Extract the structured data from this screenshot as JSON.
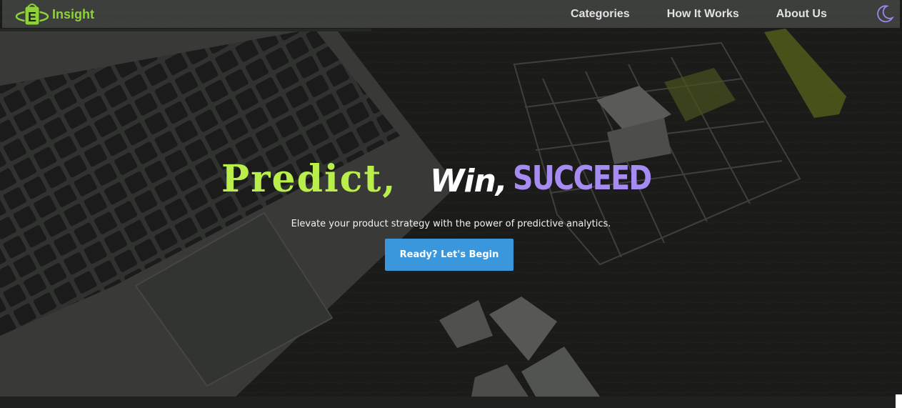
{
  "brand": {
    "logo_letter": "E",
    "name": "Insight",
    "accent_color": "#8ed13b"
  },
  "nav": {
    "links": [
      {
        "label": "Categories"
      },
      {
        "label": "How It Works"
      },
      {
        "label": "About Us"
      }
    ],
    "theme_toggle_icon": "moon-icon"
  },
  "hero": {
    "headline": {
      "part1": "Predict,",
      "part2": "Win,",
      "part3": "SUCCEED",
      "colors": [
        "#b9ee4b",
        "#ffffff",
        "#a58bf2"
      ]
    },
    "tagline": "Elevate your product strategy with the power of predictive analytics.",
    "cta_label": "Ready? Let's Begin",
    "cta_color": "#3a97dc"
  }
}
